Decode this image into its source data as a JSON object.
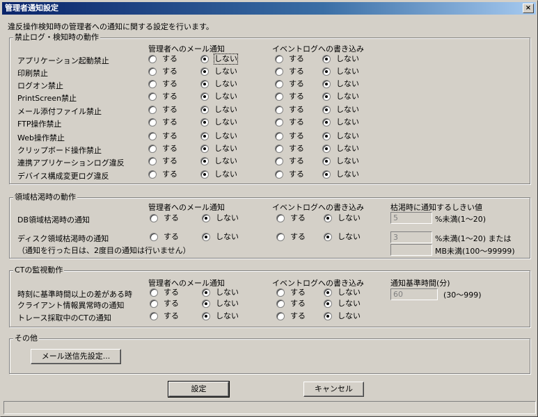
{
  "window": {
    "title": "管理者通知設定",
    "close_glyph": "×",
    "description": "違反操作検知時の管理者への通知に関する設定を行います。"
  },
  "radio_labels": {
    "yes": "する",
    "no": "しない"
  },
  "section1": {
    "legend": "禁止ログ・検知時の動作",
    "col_mail": "管理者へのメール通知",
    "col_event": "イベントログへの書き込み",
    "rows": [
      {
        "label": "アプリケーション起動禁止",
        "mail": "no",
        "event": "no"
      },
      {
        "label": "印刷禁止",
        "mail": "no",
        "event": "no"
      },
      {
        "label": "ログオン禁止",
        "mail": "no",
        "event": "no"
      },
      {
        "label": "PrintScreen禁止",
        "mail": "no",
        "event": "no"
      },
      {
        "label": "メール添付ファイル禁止",
        "mail": "no",
        "event": "no"
      },
      {
        "label": "FTP操作禁止",
        "mail": "no",
        "event": "no"
      },
      {
        "label": "Web操作禁止",
        "mail": "no",
        "event": "no"
      },
      {
        "label": "クリップボード操作禁止",
        "mail": "no",
        "event": "no"
      },
      {
        "label": "連携アプリケーションログ違反",
        "mail": "no",
        "event": "no"
      },
      {
        "label": "デバイス構成変更ログ違反",
        "mail": "no",
        "event": "no"
      }
    ]
  },
  "section2": {
    "legend": "領域枯渇時の動作",
    "col_mail": "管理者へのメール通知",
    "col_event": "イベントログへの書き込み",
    "col_threshold": "枯渇時に通知するしきい値",
    "rows": [
      {
        "label": "DB領域枯渇時の通知",
        "mail": "no",
        "event": "no"
      },
      {
        "label": "ディスク領域枯渇時の通知",
        "mail": "no",
        "event": "no"
      }
    ],
    "note": "（通知を行った日は、2度目の通知は行いません）",
    "db_threshold_value": "5",
    "db_threshold_unit": "%未満(1～20)",
    "disk_threshold_value": "3",
    "disk_threshold_unit": "%未満(1～20) または",
    "disk_mb_value": "",
    "disk_mb_unit": "MB未満(100～99999)"
  },
  "section3": {
    "legend": "CTの監視動作",
    "col_mail": "管理者へのメール通知",
    "col_event": "イベントログへの書き込み",
    "col_time": "通知基準時間(分)",
    "rows": [
      {
        "label": "時刻に基準時間以上の差がある時",
        "mail": "no",
        "event": "no"
      },
      {
        "label": "クライアント情報異常時の通知",
        "mail": "no",
        "event": "no"
      },
      {
        "label": "トレース採取中のCTの通知",
        "mail": "no",
        "event": "no"
      }
    ],
    "time_value": "60",
    "time_range": "(30～999)"
  },
  "section4": {
    "legend": "その他",
    "mail_settings_button": "メール送信先設定..."
  },
  "footer": {
    "ok_button": "設定",
    "cancel_button": "キャンセル",
    "status_text": ""
  }
}
